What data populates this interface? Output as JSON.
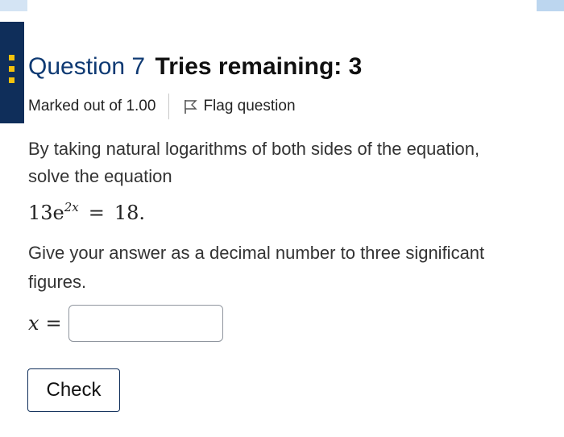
{
  "question": {
    "number_label": "Question 7",
    "tries_label": "Tries remaining: 3",
    "marked_label": "Marked out of 1.00",
    "flag_label": "Flag question",
    "prompt_line1": "By taking natural logarithms of both sides of the equation,",
    "prompt_line2": "solve the equation",
    "equation": {
      "coefficient": "13e",
      "exponent": "2x",
      "equals": "=",
      "rhs": "18."
    },
    "instruction_line1": "Give your answer as a decimal number to three significant",
    "instruction_line2": "figures.",
    "answer_variable": "x",
    "answer_equals": "=",
    "answer_value": "",
    "check_label": "Check"
  },
  "icons": {
    "flag": "flag-icon",
    "nav": "question-nav-icon"
  },
  "colors": {
    "header_blue": "#0f3a73",
    "side_tab": "#0f2e5a",
    "side_dots": "#f4c20d",
    "top_left_bar": "#d4e4f4",
    "top_right_bar": "#bcd6ef"
  }
}
